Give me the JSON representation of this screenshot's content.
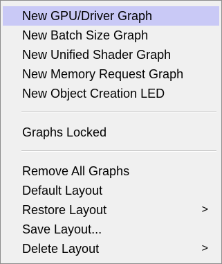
{
  "menu": {
    "items": [
      {
        "label": "New GPU/Driver Graph",
        "highlighted": true
      },
      {
        "label": "New Batch Size Graph"
      },
      {
        "label": "New Unified Shader Graph"
      },
      {
        "label": "New Memory Request Graph"
      },
      {
        "label": "New Object Creation LED"
      },
      {
        "label": "Graphs Locked"
      },
      {
        "label": "Remove All Graphs"
      },
      {
        "label": "Default Layout"
      },
      {
        "label": "Restore Layout",
        "submenu_arrow": ">"
      },
      {
        "label": "Save Layout..."
      },
      {
        "label": "Delete Layout",
        "submenu_arrow": ">"
      }
    ],
    "colors": {
      "background": "#f0f0f0",
      "highlight": "#c9c9f6",
      "text": "#000000"
    }
  }
}
